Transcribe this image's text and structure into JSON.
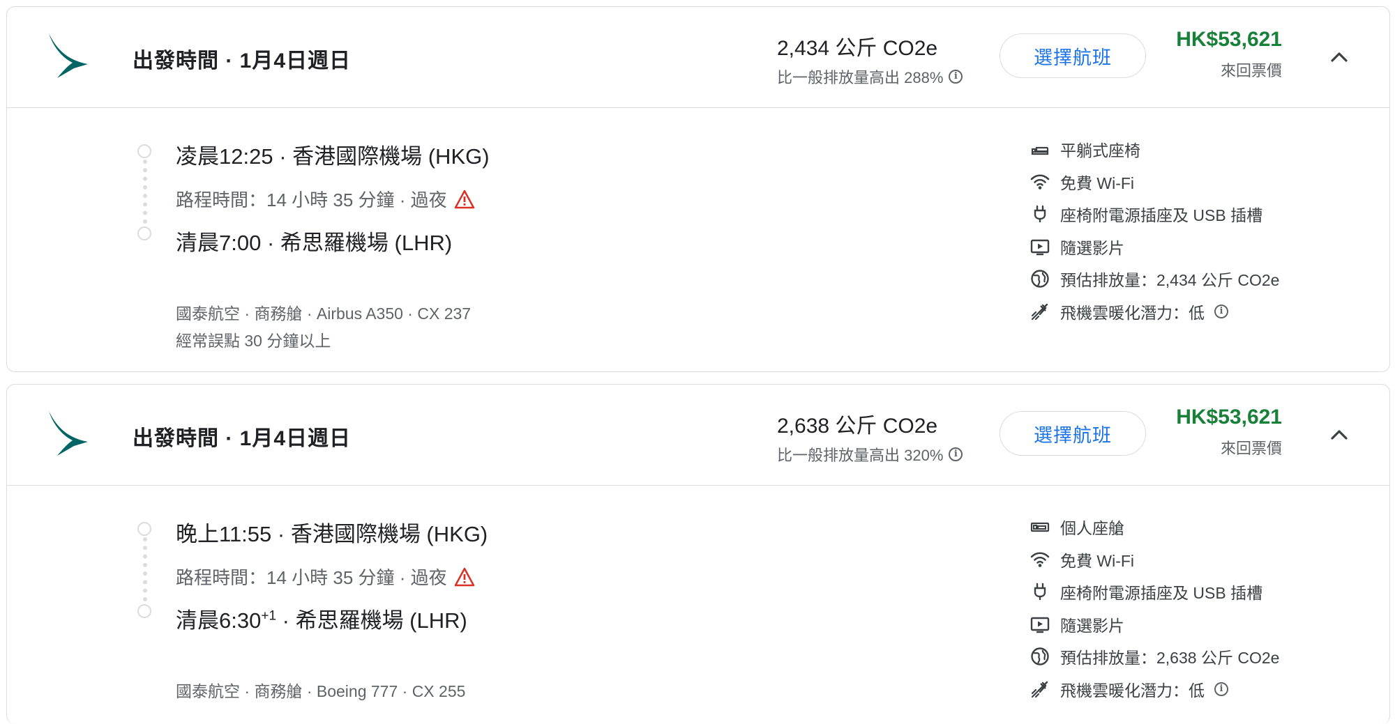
{
  "flights": [
    {
      "departure_label": "出發時間 · 1月4日週日",
      "emissions": "2,434 公斤 CO2e",
      "emissions_compare": "比一般排放量高出 288%",
      "select_label": "選擇航班",
      "price": "HK$53,621",
      "price_label": "來回票價",
      "dep_time_airport": "凌晨12:25 · 香港國際機場 (HKG)",
      "duration": "路程時間：14 小時 35 分鐘 · 過夜",
      "arr_time": "清晨7:00",
      "arr_plus": "",
      "arr_airport": " · 希思羅機場 (LHR)",
      "details": "國泰航空 · 商務艙 · Airbus A350 · CX 237",
      "delay_note": "經常誤點 30 分鐘以上",
      "amenities": [
        {
          "icon": "lie-flat-seat-icon",
          "label": "平躺式座椅"
        },
        {
          "icon": "wifi-icon",
          "label": "免費 Wi-Fi"
        },
        {
          "icon": "power-plug-icon",
          "label": "座椅附電源插座及 USB 插槽"
        },
        {
          "icon": "video-icon",
          "label": "隨選影片"
        },
        {
          "icon": "globe-icon",
          "label": "預估排放量：2,434 公斤 CO2e"
        },
        {
          "icon": "contrail-icon",
          "label": "飛機雲暖化潛力：低"
        }
      ]
    },
    {
      "departure_label": "出發時間 · 1月4日週日",
      "emissions": "2,638 公斤 CO2e",
      "emissions_compare": "比一般排放量高出 320%",
      "select_label": "選擇航班",
      "price": "HK$53,621",
      "price_label": "來回票價",
      "dep_time_airport": "晚上11:55 · 香港國際機場 (HKG)",
      "duration": "路程時間：14 小時 35 分鐘 · 過夜",
      "arr_time": "清晨6:30",
      "arr_plus": "+1",
      "arr_airport": " · 希思羅機場 (LHR)",
      "details": "國泰航空 · 商務艙 · Boeing 777 · CX 255",
      "delay_note": "",
      "amenities": [
        {
          "icon": "private-suite-icon",
          "label": "個人座艙"
        },
        {
          "icon": "wifi-icon",
          "label": "免費 Wi-Fi"
        },
        {
          "icon": "power-plug-icon",
          "label": "座椅附電源插座及 USB 插槽"
        },
        {
          "icon": "video-icon",
          "label": "隨選影片"
        },
        {
          "icon": "globe-icon",
          "label": "預估排放量：2,638 公斤 CO2e"
        },
        {
          "icon": "contrail-icon",
          "label": "飛機雲暖化潛力：低"
        }
      ]
    }
  ],
  "colors": {
    "price": "#188038",
    "accent": "#1a73e8",
    "warning": "#d93025",
    "logo": "#006564"
  }
}
